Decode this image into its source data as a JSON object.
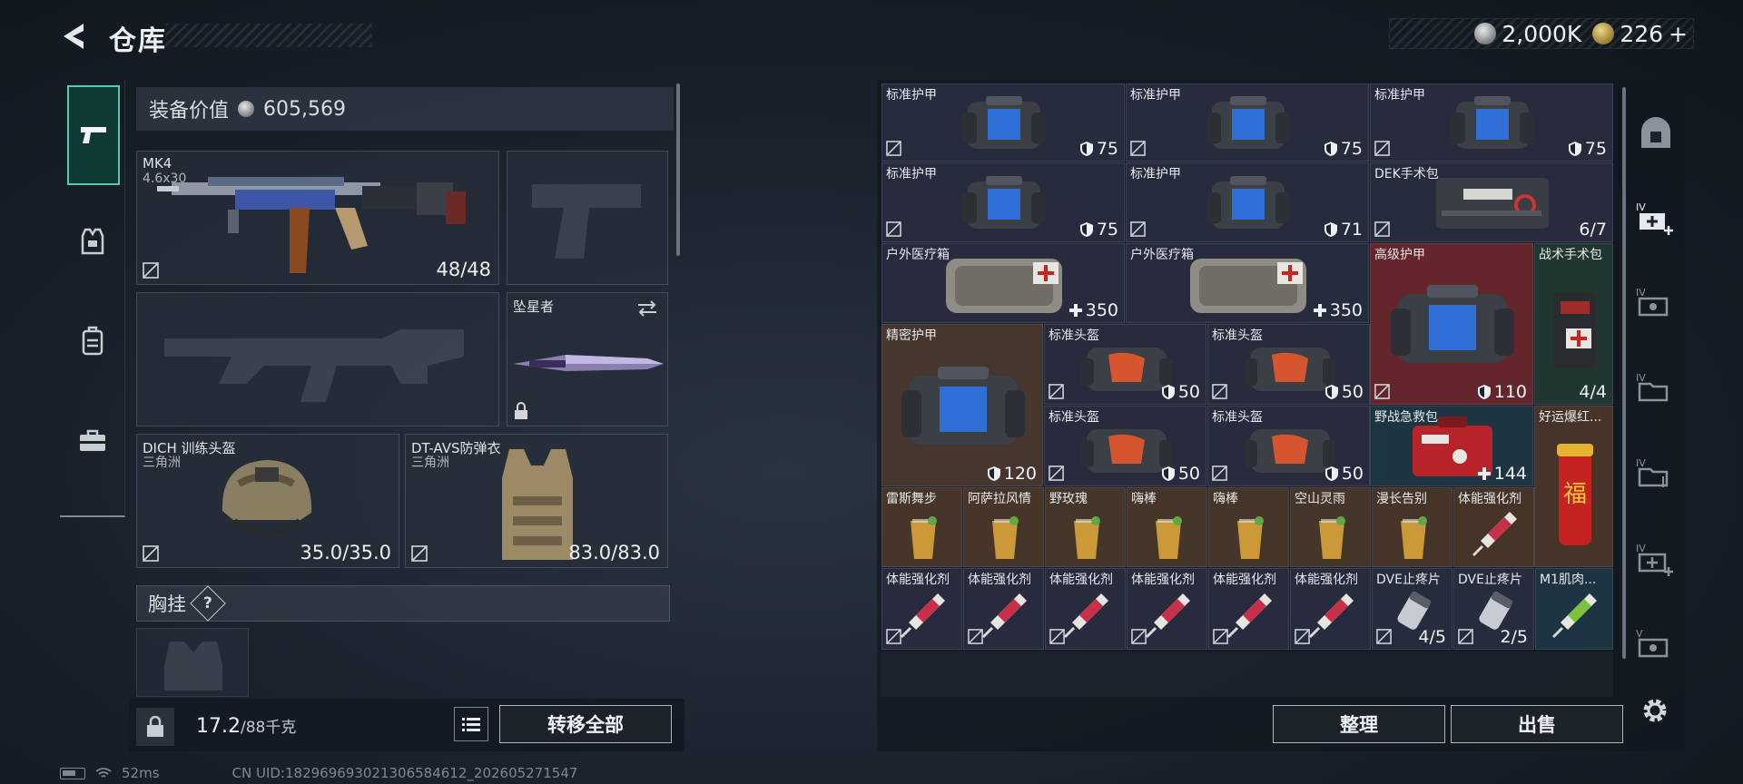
{
  "header": {
    "title": "仓库",
    "currency_silver": "2,000K",
    "currency_gold": "226",
    "currency_gold_plus": "+"
  },
  "equipment": {
    "value_label": "装备价值",
    "value": "605,569",
    "primary_weapon": {
      "name": "MK4",
      "ammo": "4.6x30",
      "durability": "48/48"
    },
    "melee": {
      "name": "坠星者"
    },
    "helmet": {
      "name": "DICH 训练头盔",
      "faction": "三角洲",
      "durability": "35.0/35.0"
    },
    "armor": {
      "name": "DT-AVS防弹衣",
      "faction": "三角洲",
      "durability": "83.0/83.0"
    },
    "chest_rig_label": "胸挂",
    "chest_rig_help": "?"
  },
  "capacity": {
    "current": "17.2",
    "max_unit": "/88千克"
  },
  "buttons": {
    "transfer_all": "转移全部",
    "sort": "整理",
    "sell": "出售"
  },
  "stash": {
    "items": [
      {
        "label": "标准护甲",
        "value": "75",
        "kind": "armor",
        "noloss": true
      },
      {
        "label": "标准护甲",
        "value": "75",
        "kind": "armor",
        "noloss": true
      },
      {
        "label": "标准护甲",
        "value": "75",
        "kind": "armor",
        "noloss": true
      },
      {
        "label": "标准护甲",
        "value": "75",
        "kind": "armor",
        "noloss": true
      },
      {
        "label": "标准护甲",
        "value": "71",
        "kind": "armor",
        "noloss": true
      },
      {
        "label": "DEK手术包",
        "value": "6/7",
        "kind": "count",
        "noloss": true
      },
      {
        "label": "户外医疗箱",
        "value": "350",
        "kind": "heal",
        "noloss": false
      },
      {
        "label": "户外医疗箱",
        "value": "350",
        "kind": "heal",
        "noloss": false
      },
      {
        "label": "高级护甲",
        "value": "110",
        "kind": "armor",
        "noloss": true
      },
      {
        "label": "战术手术包",
        "value": "4/4",
        "kind": "count",
        "noloss": false
      },
      {
        "label": "精密护甲",
        "value": "120",
        "kind": "armor",
        "noloss": false
      },
      {
        "label": "标准头盔",
        "value": "50",
        "kind": "armor",
        "noloss": true
      },
      {
        "label": "标准头盔",
        "value": "50",
        "kind": "armor",
        "noloss": true
      },
      {
        "label": "标准头盔",
        "value": "50",
        "kind": "armor",
        "noloss": true
      },
      {
        "label": "标准头盔",
        "value": "50",
        "kind": "armor",
        "noloss": true
      },
      {
        "label": "野战急救包",
        "value": "144",
        "kind": "heal",
        "noloss": false
      },
      {
        "label": "好运爆红...",
        "value": "",
        "kind": "none",
        "noloss": false
      },
      {
        "label": "雷斯舞步",
        "value": "",
        "kind": "none",
        "noloss": false
      },
      {
        "label": "阿萨拉风情",
        "value": "",
        "kind": "none",
        "noloss": false
      },
      {
        "label": "野玫瑰",
        "value": "",
        "kind": "none",
        "noloss": false
      },
      {
        "label": "嗨棒",
        "value": "",
        "kind": "none",
        "noloss": false
      },
      {
        "label": "嗨棒",
        "value": "",
        "kind": "none",
        "noloss": false
      },
      {
        "label": "空山灵雨",
        "value": "",
        "kind": "none",
        "noloss": false
      },
      {
        "label": "漫长告别",
        "value": "",
        "kind": "none",
        "noloss": false
      },
      {
        "label": "体能强化剂",
        "value": "",
        "kind": "none",
        "noloss": false
      },
      {
        "label": "体能强化剂",
        "value": "",
        "kind": "none",
        "noloss": true
      },
      {
        "label": "体能强化剂",
        "value": "",
        "kind": "none",
        "noloss": true
      },
      {
        "label": "体能强化剂",
        "value": "",
        "kind": "none",
        "noloss": true
      },
      {
        "label": "体能强化剂",
        "value": "",
        "kind": "none",
        "noloss": true
      },
      {
        "label": "体能强化剂",
        "value": "",
        "kind": "none",
        "noloss": true
      },
      {
        "label": "体能强化剂",
        "value": "",
        "kind": "none",
        "noloss": true
      },
      {
        "label": "DVE止疼片",
        "value": "4/5",
        "kind": "count",
        "noloss": true
      },
      {
        "label": "DVE止疼片",
        "value": "2/5",
        "kind": "count",
        "noloss": true
      },
      {
        "label": "M1肌肉...",
        "value": "",
        "kind": "none",
        "noloss": false
      }
    ]
  },
  "status": {
    "ping": "52ms",
    "uid": "CN UID:1829696930213065846‌12_202605271547"
  },
  "colors": {
    "accent_teal": "#5ac7b1",
    "rare_red": "#7a282c",
    "epic_brown": "#56402e"
  }
}
